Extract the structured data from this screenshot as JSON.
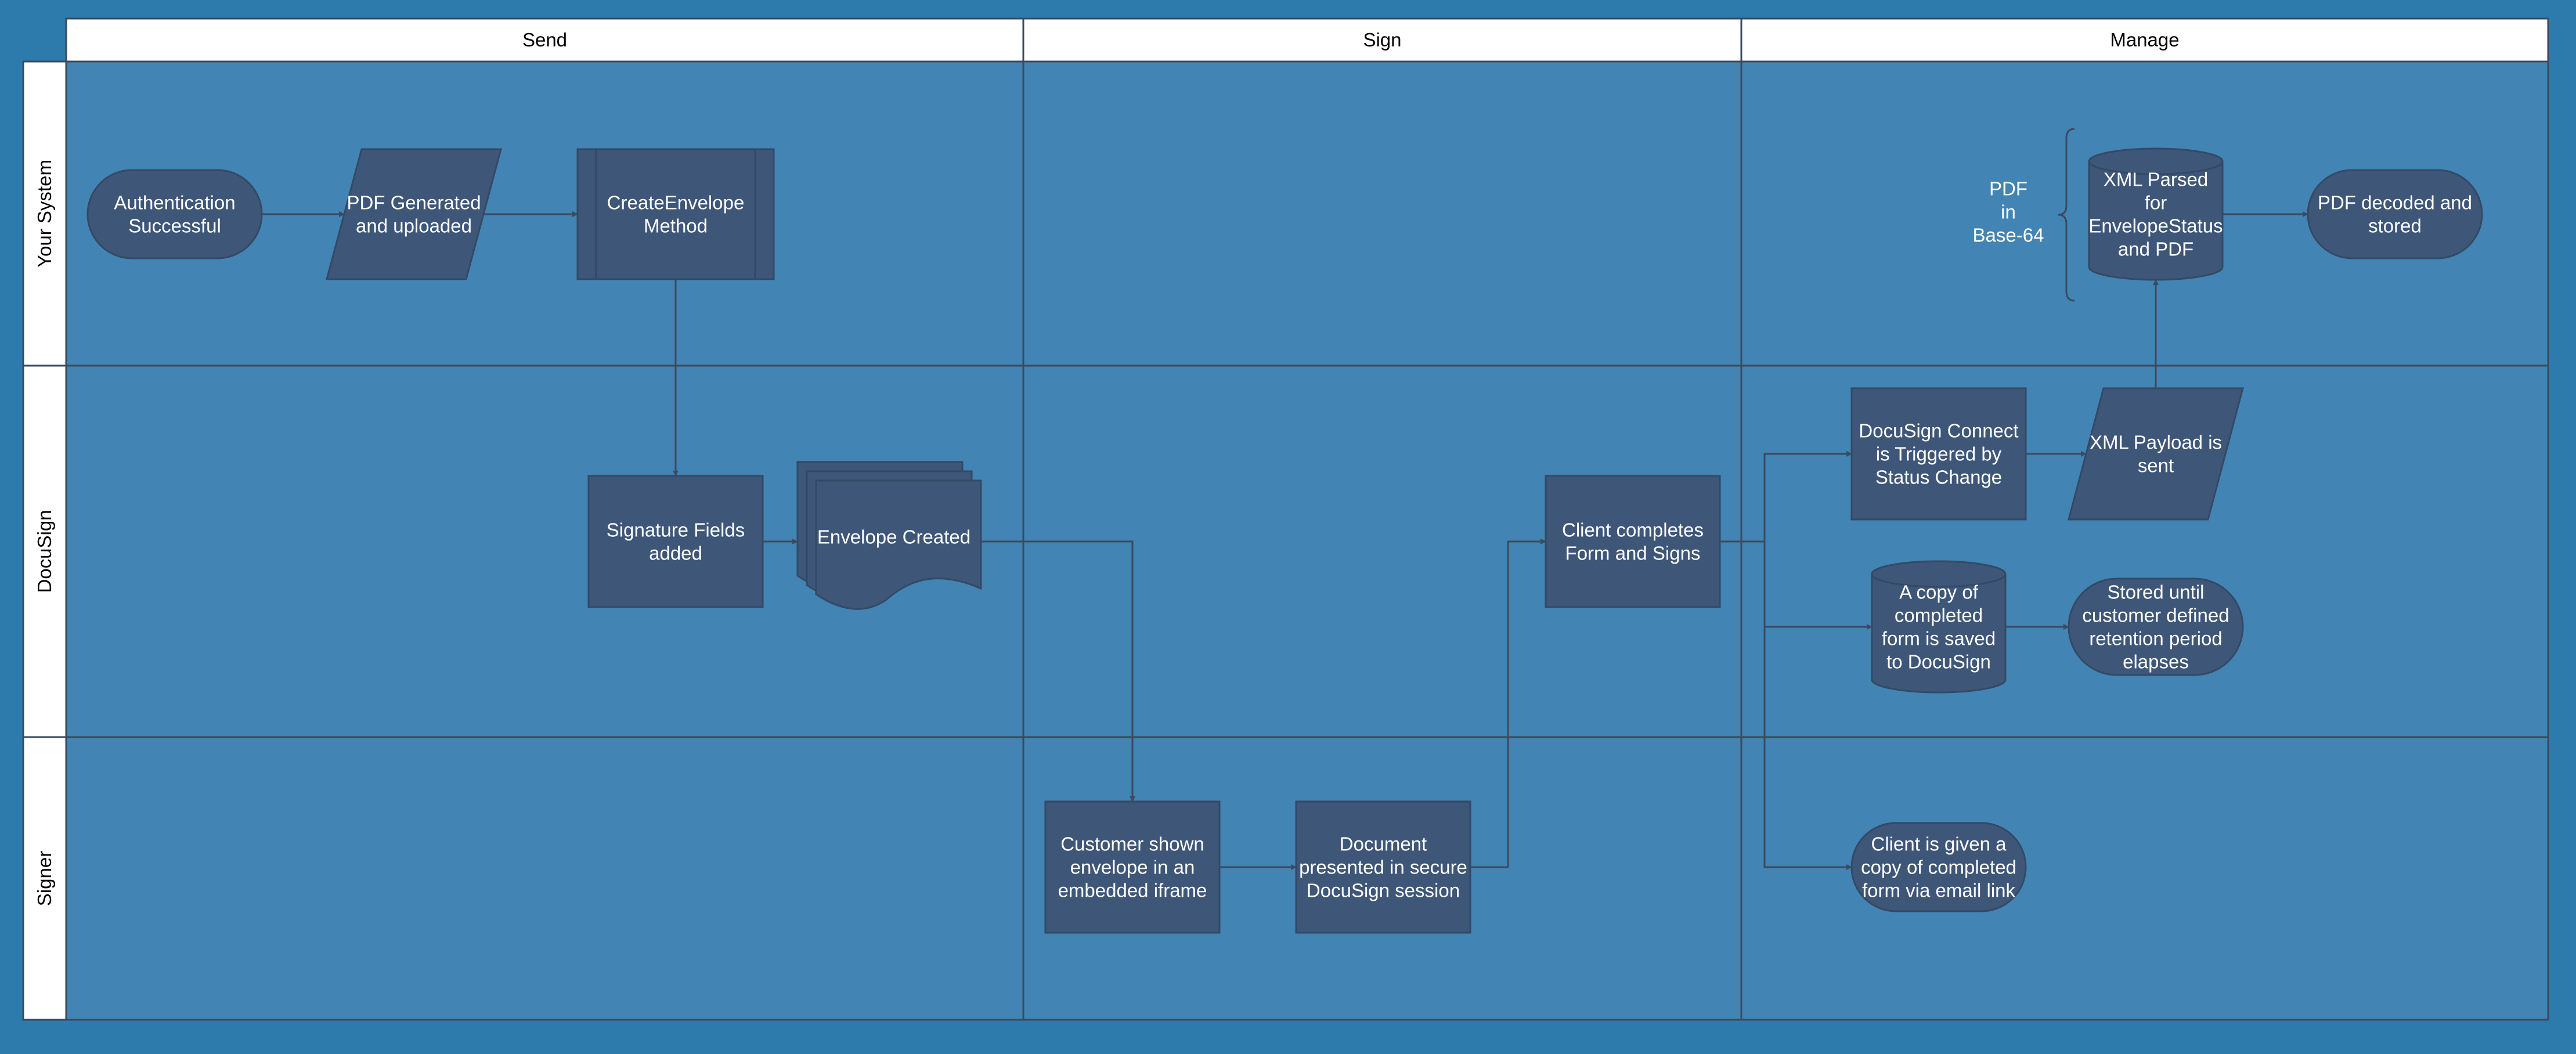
{
  "colors": {
    "background": "#2c7bac",
    "lane_fill": "#4284b3",
    "header_fill": "#ffffff",
    "node_fill": "#3e5678",
    "node_stroke": "#334966",
    "line": "#3b4a5e",
    "node_text": "#ffffff",
    "header_text": "#000000"
  },
  "columns": [
    {
      "id": "send",
      "label": "Send"
    },
    {
      "id": "sign",
      "label": "Sign"
    },
    {
      "id": "manage",
      "label": "Manage"
    }
  ],
  "lanes": [
    {
      "id": "your-system",
      "label": "Your System"
    },
    {
      "id": "docusign",
      "label": "DocuSign"
    },
    {
      "id": "signer",
      "label": "Signer"
    }
  ],
  "nodes": [
    {
      "id": "auth",
      "shape": "terminator",
      "lines": [
        "Authentication",
        "Successful"
      ]
    },
    {
      "id": "pdf",
      "shape": "data",
      "lines": [
        "PDF Generated",
        "and uploaded"
      ]
    },
    {
      "id": "create",
      "shape": "process-predefined",
      "lines": [
        "CreateEnvelope",
        "Method"
      ]
    },
    {
      "id": "xmlparsed",
      "shape": "database",
      "lines": [
        "XML Parsed",
        "for",
        "EnvelopeStatus",
        "and PDF"
      ]
    },
    {
      "id": "decoded",
      "shape": "terminator",
      "lines": [
        "PDF decoded and",
        "stored"
      ]
    },
    {
      "id": "sigfields",
      "shape": "process",
      "lines": [
        "Signature Fields",
        "added"
      ]
    },
    {
      "id": "envelope",
      "shape": "multi-document",
      "lines": [
        "Envelope Created"
      ]
    },
    {
      "id": "client",
      "shape": "process",
      "lines": [
        "Client completes",
        "Form and Signs"
      ]
    },
    {
      "id": "connect",
      "shape": "process",
      "lines": [
        "DocuSign Connect",
        "is Triggered by",
        "Status Change"
      ]
    },
    {
      "id": "payload",
      "shape": "data",
      "lines": [
        "XML Payload is",
        "sent"
      ]
    },
    {
      "id": "copy",
      "shape": "database",
      "lines": [
        "A copy of",
        "completed",
        "form is saved",
        "to DocuSign"
      ]
    },
    {
      "id": "stored",
      "shape": "terminator",
      "lines": [
        "Stored until",
        "customer defined",
        "retention period",
        "elapses"
      ]
    },
    {
      "id": "iframe",
      "shape": "process",
      "lines": [
        "Customer shown",
        "envelope in an",
        "embedded iframe"
      ]
    },
    {
      "id": "session",
      "shape": "process",
      "lines": [
        "Document",
        "presented in secure",
        "DocuSign session"
      ]
    },
    {
      "id": "emaillink",
      "shape": "terminator",
      "lines": [
        "Client is given a",
        "copy of completed",
        "form via email link"
      ]
    }
  ],
  "annotation": {
    "id": "base64",
    "lines": [
      "PDF",
      "in",
      "Base-64"
    ]
  },
  "connectors": [
    {
      "from": "auth",
      "to": "pdf"
    },
    {
      "from": "pdf",
      "to": "create"
    },
    {
      "from": "create",
      "to": "sigfields"
    },
    {
      "from": "sigfields",
      "to": "envelope"
    },
    {
      "from": "envelope",
      "to": "iframe"
    },
    {
      "from": "iframe",
      "to": "session"
    },
    {
      "from": "session",
      "to": "client"
    },
    {
      "from": "client",
      "to": "connect"
    },
    {
      "from": "client",
      "to": "copy"
    },
    {
      "from": "client",
      "to": "emaillink"
    },
    {
      "from": "connect",
      "to": "payload"
    },
    {
      "from": "payload",
      "to": "xmlparsed"
    },
    {
      "from": "xmlparsed",
      "to": "decoded"
    },
    {
      "from": "copy",
      "to": "stored"
    }
  ]
}
